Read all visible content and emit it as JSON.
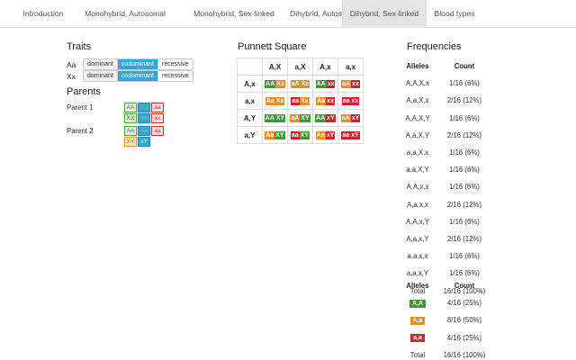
{
  "tabs": [
    {
      "label": "Introduction",
      "active": false
    },
    {
      "label": "Monohybrid, Autosomal",
      "active": false
    },
    {
      "label": "Monohybrid, Sex-linked",
      "active": false
    },
    {
      "label": "Dihybrid, Autosomal",
      "active": false
    },
    {
      "label": "Dihybrid, Sex-linked",
      "active": true
    },
    {
      "label": "Blood types",
      "active": false
    }
  ],
  "traits": {
    "title": "Traits",
    "rows": [
      {
        "name": "Aa",
        "options": [
          "dominant",
          "codominant",
          "recessive"
        ],
        "selected": "codominant"
      },
      {
        "name": "Xx",
        "options": [
          "dominant",
          "codominant",
          "recessive"
        ],
        "selected": "codominant"
      }
    ]
  },
  "parents": {
    "title": "Parents",
    "parent1": {
      "label": "Parent 1",
      "row1": [
        "AA",
        "Aa",
        "aa"
      ],
      "row2": [
        "XX",
        "Xx",
        "xx"
      ],
      "selected1": "Aa",
      "selected2": "Xx"
    },
    "parent2": {
      "label": "Parent 2",
      "row1": [
        "AA",
        "Aa",
        "aa"
      ],
      "row2": [
        "XY",
        "xY"
      ],
      "selected1": "Aa",
      "selected2": "xY"
    }
  },
  "punnett": {
    "title": "Punnett Square",
    "col_headers": [
      "A,X",
      "a,X",
      "A,x",
      "a,x"
    ],
    "rows": [
      {
        "header": "A,x",
        "cells": [
          [
            "AA",
            "Xx",
            "g",
            "o"
          ],
          [
            "aA",
            "Xx",
            "o",
            "o"
          ],
          [
            "AA",
            "xx",
            "g",
            "r"
          ],
          [
            "aA",
            "xx",
            "o",
            "r"
          ]
        ]
      },
      {
        "header": "a,x",
        "cells": [
          [
            "Aa",
            "Xx",
            "o",
            "o"
          ],
          [
            "aa",
            "Xx",
            "r",
            "o"
          ],
          [
            "Aa",
            "xx",
            "o",
            "r"
          ],
          [
            "aa",
            "xx",
            "r",
            "r"
          ]
        ]
      },
      {
        "header": "A,Y",
        "cells": [
          [
            "AA",
            "XY",
            "g",
            "g"
          ],
          [
            "aA",
            "XY",
            "o",
            "g"
          ],
          [
            "AA",
            "xY",
            "g",
            "r"
          ],
          [
            "aA",
            "xY",
            "o",
            "r"
          ]
        ]
      },
      {
        "header": "a,Y",
        "cells": [
          [
            "Aa",
            "XY",
            "o",
            "g"
          ],
          [
            "aa",
            "XY",
            "r",
            "g"
          ],
          [
            "Aa",
            "xY",
            "o",
            "r"
          ],
          [
            "aa",
            "xY",
            "r",
            "r"
          ]
        ]
      }
    ]
  },
  "frequencies": {
    "title": "Frequencies",
    "headers": [
      "Alleles",
      "Count"
    ],
    "rows": [
      [
        "A,A,X,x",
        "1/16 (6%)"
      ],
      [
        "A,a,X,x",
        "2/16 (12%)"
      ],
      [
        "A,A,X,Y",
        "1/16 (6%)"
      ],
      [
        "A,a,X,Y",
        "2/16 (12%)"
      ],
      [
        "a,a,X,x",
        "1/16 (6%)"
      ],
      [
        "a,a,X,Y",
        "1/16 (6%)"
      ],
      [
        "A,A,x,x",
        "1/16 (6%)"
      ],
      [
        "A,a,x,x",
        "2/16 (12%)"
      ],
      [
        "A,A,x,Y",
        "1/16 (6%)"
      ],
      [
        "A,a,x,Y",
        "2/16 (12%)"
      ],
      [
        "a,a,x,x",
        "1/16 (6%)"
      ],
      [
        "a,a,x,Y",
        "1/16 (6%)"
      ]
    ],
    "total": [
      "Total",
      "16/16 (100%)"
    ],
    "headers2": [
      "Alleles",
      "Count"
    ],
    "rows2": [
      {
        "label": "A,A",
        "color": "g",
        "count": "4/16 (25%)"
      },
      {
        "label": "A,a",
        "color": "o",
        "count": "8/16 (50%)"
      },
      {
        "label": "a,a",
        "color": "r",
        "count": "4/16 (25%)"
      }
    ],
    "total2": [
      "Total",
      "16/16 (100%)"
    ]
  },
  "colors": {
    "green": "#3a9a33",
    "orange": "#e58e26",
    "red": "#c6262e",
    "blue": "#31a8d6"
  }
}
